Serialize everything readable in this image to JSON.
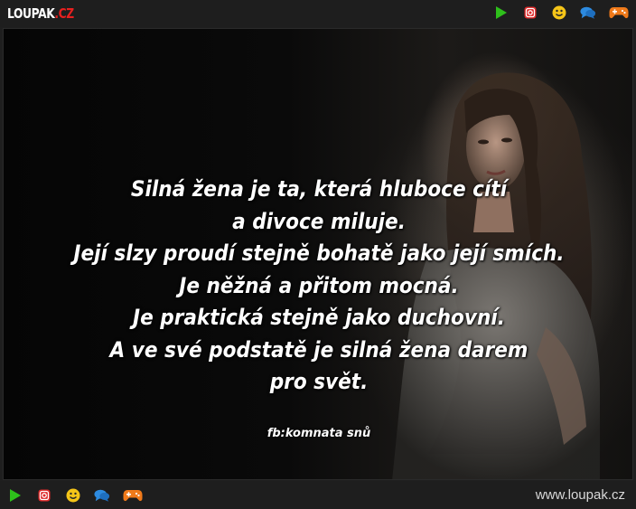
{
  "header": {
    "logo_main": "LOUPAK",
    "logo_tld": ".CZ"
  },
  "icons": [
    "play-icon",
    "instagram-icon",
    "smiley-icon",
    "chat-icon",
    "gamepad-icon"
  ],
  "colors": {
    "play": "#2ec01b",
    "instagram": "#e02a2a",
    "smiley": "#f5c518",
    "chat": "#2d8be0",
    "gamepad": "#f07a1a",
    "brand_red": "#e8201f"
  },
  "quote": {
    "lines": [
      "Silná žena je ta, která hluboce cítí",
      "a divoce miluje.",
      "Její slzy proudí stejně bohatě jako její smích.",
      "Je něžná a přitom mocná.",
      "Je praktická stejně jako duchovní.",
      "A ve své podstatě je silná žena darem",
      "pro svět."
    ],
    "credit": "fb:komnata snů"
  },
  "footer": {
    "url": "www.loupak.cz"
  }
}
